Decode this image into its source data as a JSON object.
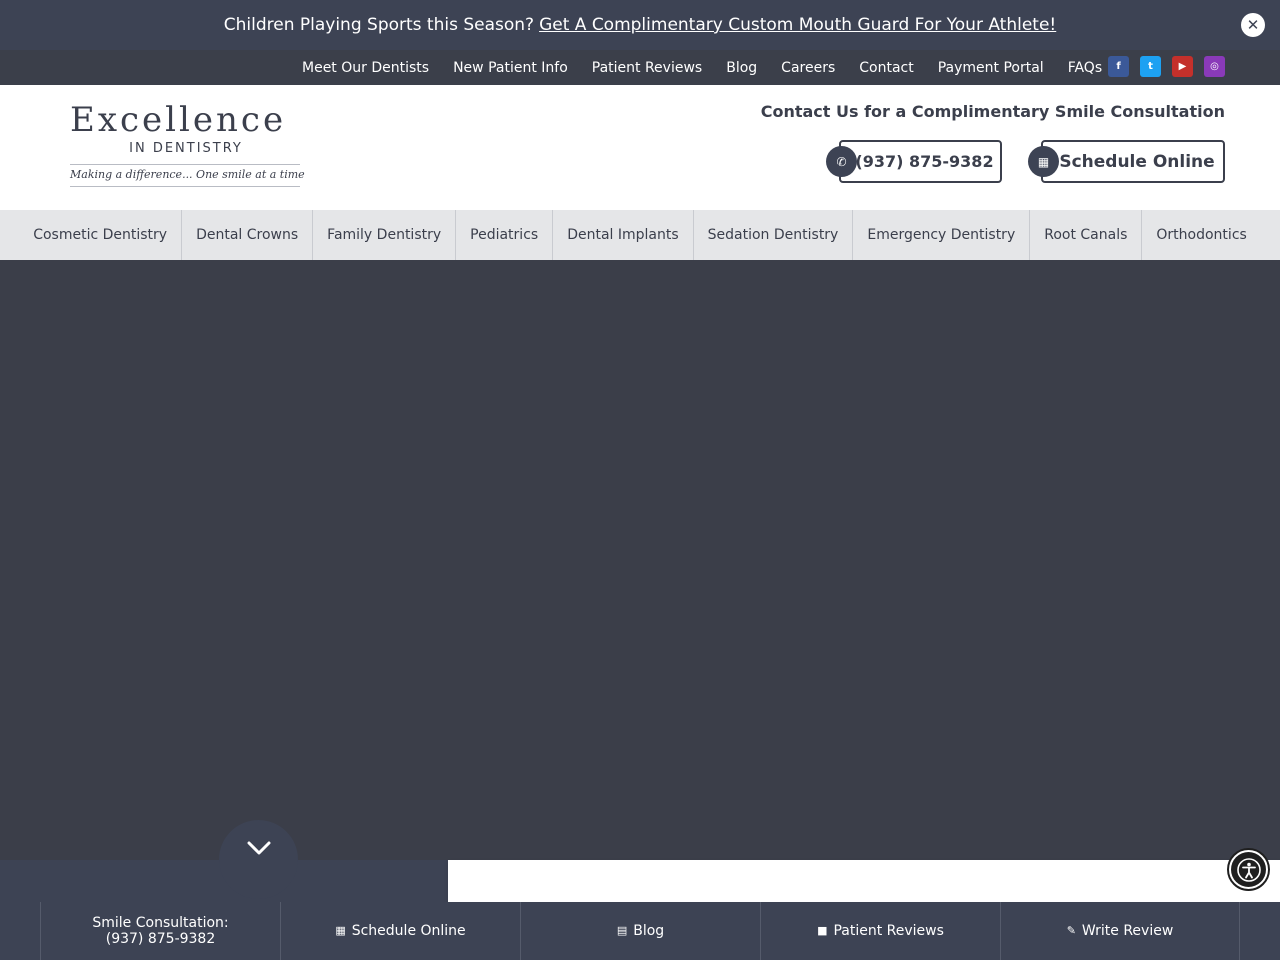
{
  "announcement": {
    "lead": "Children Playing Sports this Season?",
    "link": "Get A Complimentary Custom Mouth Guard For Your Athlete!",
    "close_icon": "close-icon"
  },
  "utility_nav": {
    "items": [
      "Meet Our Dentists",
      "New Patient Info",
      "Patient Reviews",
      "Blog",
      "Careers",
      "Contact",
      "Payment Portal",
      "FAQs"
    ]
  },
  "social": [
    {
      "icon": "facebook-icon",
      "glyph": "f",
      "color": "#3b5998"
    },
    {
      "icon": "twitter-icon",
      "glyph": "t",
      "color": "#1da1f2"
    },
    {
      "icon": "youtube-icon",
      "glyph": "▶",
      "color": "#c4302b"
    },
    {
      "icon": "instagram-icon",
      "glyph": "◎",
      "color": "#8a3ab9"
    }
  ],
  "logo": {
    "word": "Excellence",
    "sub": "IN DENTISTRY",
    "tagline": "Making a difference... One smile at a time"
  },
  "header": {
    "contact_heading": "Contact Us for a Complimentary Smile Consultation",
    "phone_label": "(937) 875-9382",
    "phone_icon": "phone-icon",
    "schedule_label": "Schedule Online",
    "schedule_icon": "calendar-icon"
  },
  "services_nav": {
    "items": [
      "Cosmetic Dentistry",
      "Dental Crowns",
      "Family Dentistry",
      "Pediatrics",
      "Dental Implants",
      "Sedation Dentistry",
      "Emergency Dentistry",
      "Root Canals",
      "Orthodontics"
    ]
  },
  "hero": {
    "scroll_icon": "chevron-down-icon"
  },
  "bottom_bar": {
    "consult_line1": "Smile Consultation:",
    "consult_line2": "(937) 875-9382",
    "schedule": "Schedule Online",
    "blog": "Blog",
    "reviews": "Patient Reviews",
    "write_review": "Write Review"
  },
  "colors": {
    "primary_dark": "#3d4354",
    "hero_bg": "#3b3e49",
    "nav_bg": "#e5e6e8"
  }
}
